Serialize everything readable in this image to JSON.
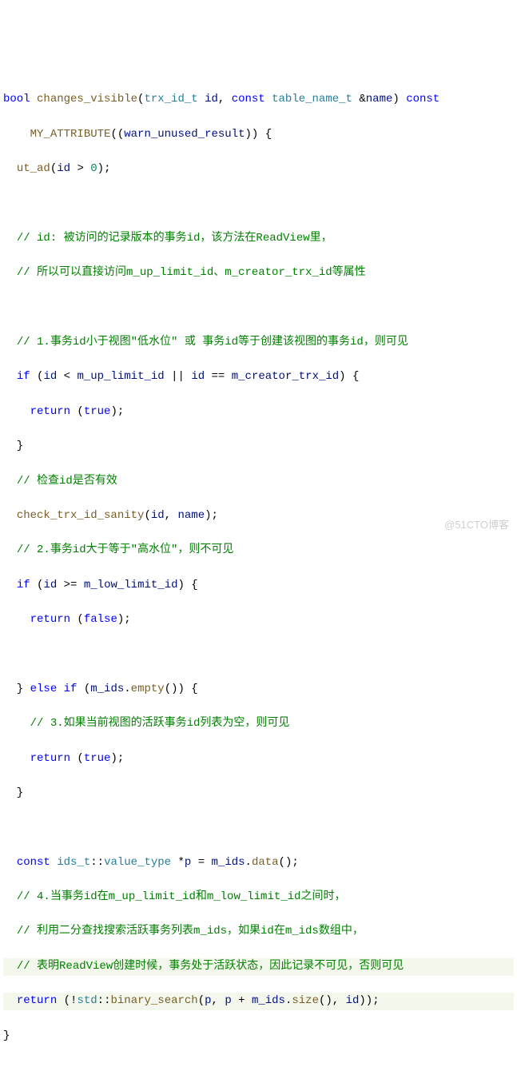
{
  "code": {
    "l1_bool": "bool",
    "l1_fn": "changes_visible",
    "l1_p_t1": "trx_id_t",
    "l1_p_n1": "id",
    "l1_const": "const",
    "l1_p_t2": "table_name_t",
    "l1_amp": "&",
    "l1_p_n2": "name",
    "l1_tail_const": "const",
    "l2_attr": "MY_ATTRIBUTE",
    "l2_inner": "warn_unused_result",
    "l3_macro": "ut_ad",
    "l3_id": "id",
    "l3_gt": ">",
    "l3_zero": "0",
    "c1": "// id: 被访问的记录版本的事务id，该方法在ReadView里，",
    "c2": "// 所以可以直接访问m_up_limit_id、m_creator_trx_id等属性",
    "c3": "// 1.事务id小于视图\"低水位\" 或 事务id等于创建该视图的事务id，则可见",
    "if1_if": "if",
    "if1_id": "id",
    "if1_lt": "<",
    "if1_m1": "m_up_limit_id",
    "if1_or": "||",
    "if1_eq": "==",
    "if1_m2": "m_creator_trx_id",
    "ret_kw": "return",
    "true_kw": "true",
    "false_kw": "false",
    "c4": "// 检查id是否有效",
    "chk_fn": "check_trx_id_sanity",
    "chk_a1": "id",
    "chk_a2": "name",
    "c5": "// 2.事务id大于等于\"高水位\"，则不可见",
    "if2_if": "if",
    "if2_id": "id",
    "if2_ge": ">=",
    "if2_m": "m_low_limit_id",
    "else_kw": "else",
    "elif_if": "if",
    "elif_m": "m_ids",
    "elif_fn": "empty",
    "c6": "// 3.如果当前视图的活跃事务id列表为空，则可见",
    "decl_const": "const",
    "decl_t": "ids_t",
    "decl_v": "value_type",
    "decl_p": "p",
    "decl_m": "m_ids",
    "decl_fn": "data",
    "c7": "// 4.当事务id在m_up_limit_id和m_low_limit_id之间时，",
    "c8": "// 利用二分查找搜索活跃事务列表m_ids，如果id在m_ids数组中，",
    "c9": "// 表明ReadView创建时候，事务处于活跃状态，因此记录不可见，否则可见",
    "ret2_not": "!",
    "ret2_ns": "std",
    "ret2_fn": "binary_search",
    "ret2_p": "p",
    "ret2_plus": "+",
    "ret2_m": "m_ids",
    "ret2_size": "size",
    "ret2_id": "id"
  },
  "watermark": "@51CTO博客"
}
